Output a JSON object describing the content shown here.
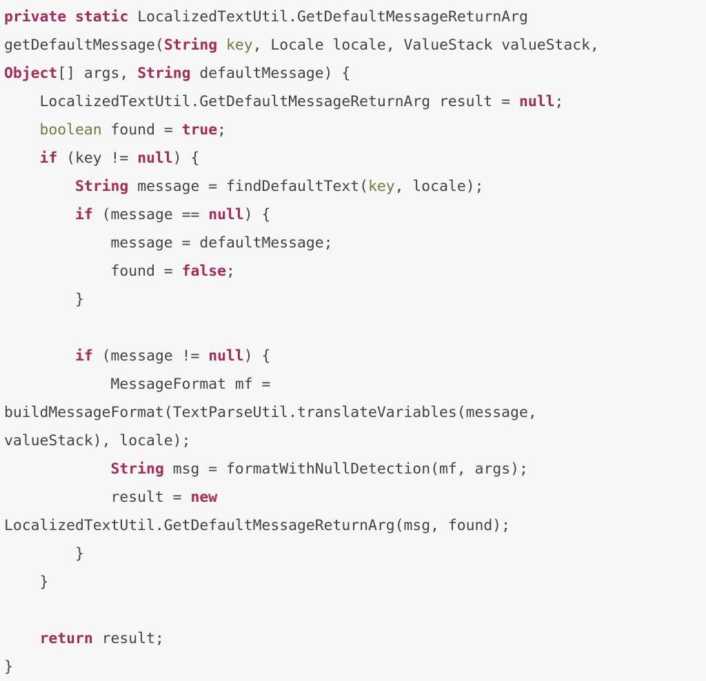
{
  "code_block": {
    "language": "java",
    "background_color": "#f7f7f7",
    "colors": {
      "plain": "#3f4349",
      "keyword": "#a52a55",
      "type": "#a52a55",
      "literal": "#a52a55",
      "parameter": "#6a7d3c"
    },
    "lines": [
      {
        "index": 0,
        "text": "private static LocalizedTextUtil.GetDefaultMessageReturnArg",
        "tokens": [
          {
            "t": "private",
            "k": "kw"
          },
          {
            "t": " ",
            "k": "plain"
          },
          {
            "t": "static",
            "k": "kw"
          },
          {
            "t": " LocalizedTextUtil.GetDefaultMessageReturnArg",
            "k": "plain"
          }
        ]
      },
      {
        "index": 1,
        "text": "getDefaultMessage(String key, Locale locale, ValueStack valueStack,",
        "tokens": [
          {
            "t": "getDefaultMessage(",
            "k": "plain"
          },
          {
            "t": "String",
            "k": "type"
          },
          {
            "t": " ",
            "k": "plain"
          },
          {
            "t": "key",
            "k": "param"
          },
          {
            "t": ", Locale locale, ValueStack valueStack,",
            "k": "plain"
          }
        ]
      },
      {
        "index": 2,
        "text": "Object[] args, String defaultMessage) {",
        "tokens": [
          {
            "t": "Object",
            "k": "type"
          },
          {
            "t": "[] args, ",
            "k": "plain"
          },
          {
            "t": "String",
            "k": "type"
          },
          {
            "t": " defaultMessage) {",
            "k": "plain"
          }
        ]
      },
      {
        "index": 3,
        "text": "    LocalizedTextUtil.GetDefaultMessageReturnArg result = null;",
        "tokens": [
          {
            "t": "    LocalizedTextUtil.GetDefaultMessageReturnArg result = ",
            "k": "plain"
          },
          {
            "t": "null",
            "k": "lit"
          },
          {
            "t": ";",
            "k": "plain"
          }
        ]
      },
      {
        "index": 4,
        "text": "    boolean found = true;",
        "tokens": [
          {
            "t": "    ",
            "k": "plain"
          },
          {
            "t": "boolean",
            "k": "param"
          },
          {
            "t": " found = ",
            "k": "plain"
          },
          {
            "t": "true",
            "k": "lit"
          },
          {
            "t": ";",
            "k": "plain"
          }
        ]
      },
      {
        "index": 5,
        "text": "    if (key != null) {",
        "tokens": [
          {
            "t": "    ",
            "k": "plain"
          },
          {
            "t": "if",
            "k": "kw"
          },
          {
            "t": " (key != ",
            "k": "plain"
          },
          {
            "t": "null",
            "k": "lit"
          },
          {
            "t": ") {",
            "k": "plain"
          }
        ]
      },
      {
        "index": 6,
        "text": "        String message = findDefaultText(key, locale);",
        "tokens": [
          {
            "t": "        ",
            "k": "plain"
          },
          {
            "t": "String",
            "k": "type"
          },
          {
            "t": " message = findDefaultText(",
            "k": "plain"
          },
          {
            "t": "key",
            "k": "param"
          },
          {
            "t": ", locale);",
            "k": "plain"
          }
        ]
      },
      {
        "index": 7,
        "text": "        if (message == null) {",
        "tokens": [
          {
            "t": "        ",
            "k": "plain"
          },
          {
            "t": "if",
            "k": "kw"
          },
          {
            "t": " (message == ",
            "k": "plain"
          },
          {
            "t": "null",
            "k": "lit"
          },
          {
            "t": ") {",
            "k": "plain"
          }
        ]
      },
      {
        "index": 8,
        "text": "            message = defaultMessage;",
        "tokens": [
          {
            "t": "            message = defaultMessage;",
            "k": "plain"
          }
        ]
      },
      {
        "index": 9,
        "text": "            found = false;",
        "tokens": [
          {
            "t": "            found = ",
            "k": "plain"
          },
          {
            "t": "false",
            "k": "lit"
          },
          {
            "t": ";",
            "k": "plain"
          }
        ]
      },
      {
        "index": 10,
        "text": "        }",
        "tokens": [
          {
            "t": "        }",
            "k": "plain"
          }
        ]
      },
      {
        "index": 11,
        "text": "",
        "tokens": [
          {
            "t": " ",
            "k": "plain"
          }
        ]
      },
      {
        "index": 12,
        "text": "        if (message != null) {",
        "tokens": [
          {
            "t": "        ",
            "k": "plain"
          },
          {
            "t": "if",
            "k": "kw"
          },
          {
            "t": " (message != ",
            "k": "plain"
          },
          {
            "t": "null",
            "k": "lit"
          },
          {
            "t": ") {",
            "k": "plain"
          }
        ]
      },
      {
        "index": 13,
        "text": "            MessageFormat mf =",
        "tokens": [
          {
            "t": "            MessageFormat mf =",
            "k": "plain"
          }
        ]
      },
      {
        "index": 14,
        "text": "buildMessageFormat(TextParseUtil.translateVariables(message,",
        "tokens": [
          {
            "t": "buildMessageFormat(TextParseUtil.translateVariables(message,",
            "k": "plain"
          }
        ]
      },
      {
        "index": 15,
        "text": "valueStack), locale);",
        "tokens": [
          {
            "t": "valueStack), locale);",
            "k": "plain"
          }
        ]
      },
      {
        "index": 16,
        "text": "            String msg = formatWithNullDetection(mf, args);",
        "tokens": [
          {
            "t": "            ",
            "k": "plain"
          },
          {
            "t": "String",
            "k": "type"
          },
          {
            "t": " msg = formatWithNullDetection(mf, args);",
            "k": "plain"
          }
        ]
      },
      {
        "index": 17,
        "text": "            result = new",
        "tokens": [
          {
            "t": "            result = ",
            "k": "plain"
          },
          {
            "t": "new",
            "k": "kw"
          }
        ]
      },
      {
        "index": 18,
        "text": "LocalizedTextUtil.GetDefaultMessageReturnArg(msg, found);",
        "tokens": [
          {
            "t": "LocalizedTextUtil.GetDefaultMessageReturnArg(msg, found);",
            "k": "plain"
          }
        ]
      },
      {
        "index": 19,
        "text": "        }",
        "tokens": [
          {
            "t": "        }",
            "k": "plain"
          }
        ]
      },
      {
        "index": 20,
        "text": "    }",
        "tokens": [
          {
            "t": "    }",
            "k": "plain"
          }
        ]
      },
      {
        "index": 21,
        "text": "",
        "tokens": [
          {
            "t": " ",
            "k": "plain"
          }
        ]
      },
      {
        "index": 22,
        "text": "    return result;",
        "tokens": [
          {
            "t": "    ",
            "k": "plain"
          },
          {
            "t": "return",
            "k": "kw"
          },
          {
            "t": " result;",
            "k": "plain"
          }
        ]
      },
      {
        "index": 23,
        "text": "}",
        "tokens": [
          {
            "t": "}",
            "k": "plain"
          }
        ]
      }
    ]
  }
}
